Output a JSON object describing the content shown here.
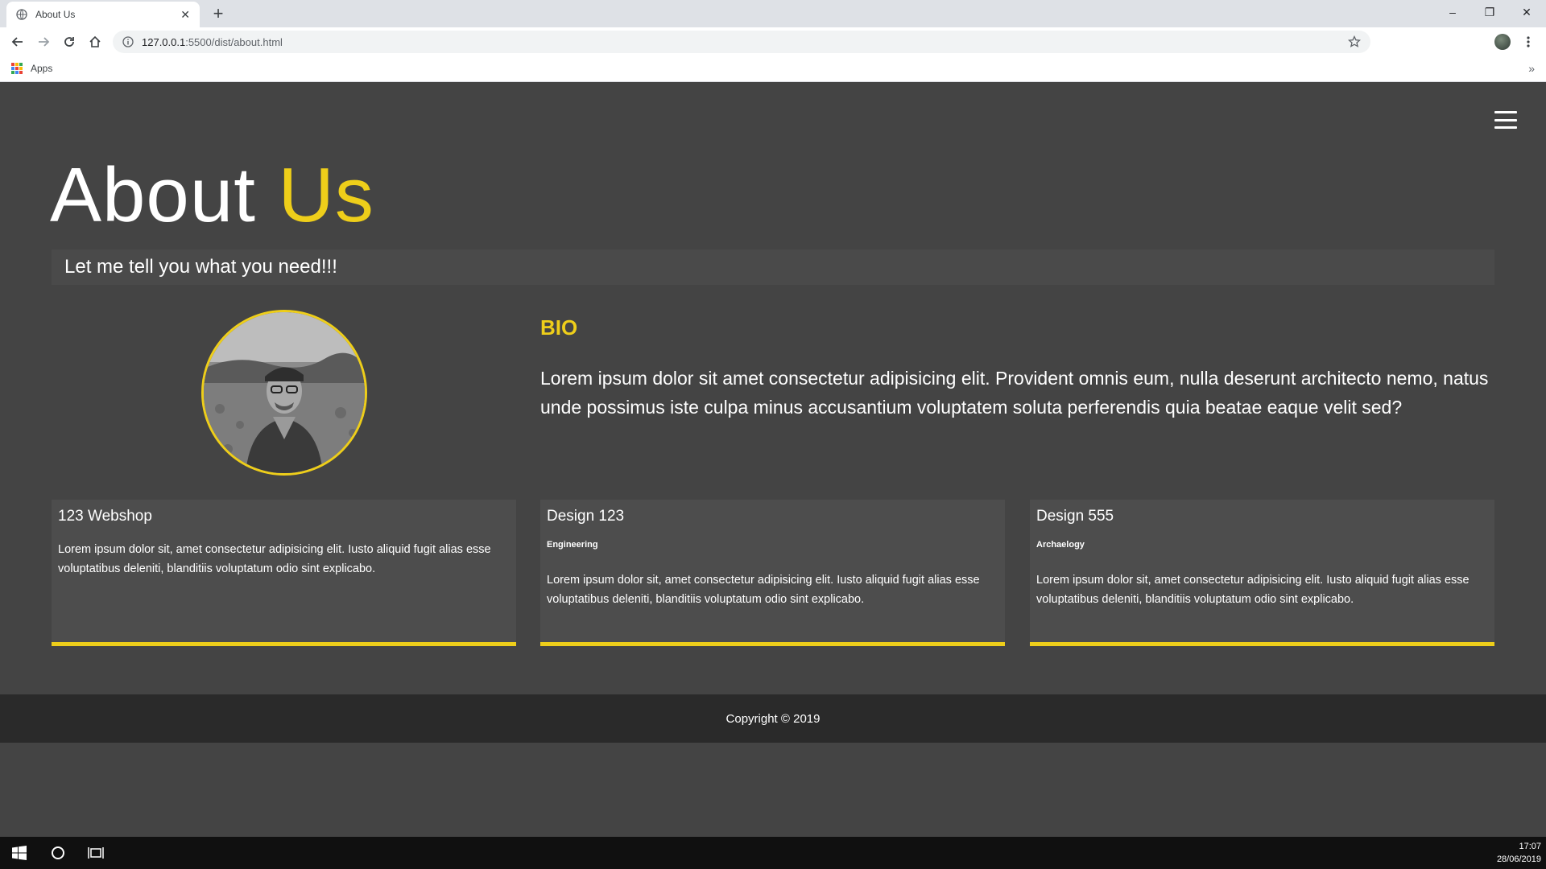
{
  "browser": {
    "tab_title": "About Us",
    "new_tab_symbol": "+",
    "tab_close_symbol": "✕",
    "url_host": "127.0.0.1",
    "url_rest": ":5500/dist/about.html",
    "bookmarks_apps_label": "Apps",
    "bookmarks_more_symbol": "»",
    "window_controls": {
      "minimize": "–",
      "maximize": "❐",
      "close": "✕"
    }
  },
  "page": {
    "title_main": "About",
    "title_accent": "Us",
    "tagline": "Let me tell you what you need!!!",
    "bio_heading": "BIO",
    "bio_text": "Lorem ipsum dolor sit amet consectetur adipisicing elit. Provident omnis eum, nulla deserunt architecto nemo, natus unde possimus iste culpa minus accusantium voluptatem soluta perferendis quia beatae eaque velit sed?",
    "boxes": [
      {
        "title": "123 Webshop",
        "subtitle": "",
        "text": "Lorem ipsum dolor sit, amet consectetur adipisicing elit. Iusto aliquid fugit alias esse voluptatibus deleniti, blanditiis voluptatum odio sint explicabo."
      },
      {
        "title": "Design 123",
        "subtitle": "Engineering",
        "text": "Lorem ipsum dolor sit, amet consectetur adipisicing elit. Iusto aliquid fugit alias esse voluptatibus deleniti, blanditiis voluptatum odio sint explicabo."
      },
      {
        "title": "Design 555",
        "subtitle": "Archaelogy",
        "text": "Lorem ipsum dolor sit, amet consectetur adipisicing elit. Iusto aliquid fugit alias esse voluptatibus deleniti, blanditiis voluptatum odio sint explicabo."
      }
    ],
    "footer": "Copyright © 2019"
  },
  "taskbar": {
    "time": "17:07",
    "date": "28/06/2019"
  },
  "colors": {
    "accent": "#eece1a",
    "background": "#444444",
    "footer": "#2a2a2a",
    "box": "#4d4d4d"
  },
  "icons": [
    "globe-icon",
    "back-icon",
    "forward-icon",
    "reload-icon",
    "home-icon",
    "info-icon",
    "star-icon",
    "kebab-menu-icon",
    "apps-grid-icon",
    "hamburger-menu-icon",
    "windows-start-icon",
    "cortana-search-icon",
    "task-view-icon"
  ]
}
